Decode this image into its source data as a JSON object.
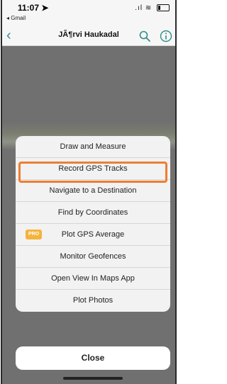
{
  "status_bar": {
    "time": "11:07",
    "back_app": "◂ Gmail"
  },
  "nav": {
    "title": "JÃ¶rvi Haukadal",
    "back_icon": "chevron-left-icon",
    "search_icon": "search-icon",
    "info_icon": "info-icon",
    "accent_color": "#2e8e8a"
  },
  "sheet": {
    "items": [
      {
        "label": "Draw and Measure"
      },
      {
        "label": "Record GPS Tracks",
        "highlighted": true
      },
      {
        "label": "Navigate to a Destination"
      },
      {
        "label": "Find by Coordinates"
      },
      {
        "label": "Plot GPS Average",
        "badge": "PRO"
      },
      {
        "label": "Monitor Geofences"
      },
      {
        "label": "Open View In Maps App"
      },
      {
        "label": "Plot Photos"
      }
    ],
    "highlight_color": "#ee7d33",
    "badge_color": "#f3b33c"
  },
  "close_label": "Close"
}
